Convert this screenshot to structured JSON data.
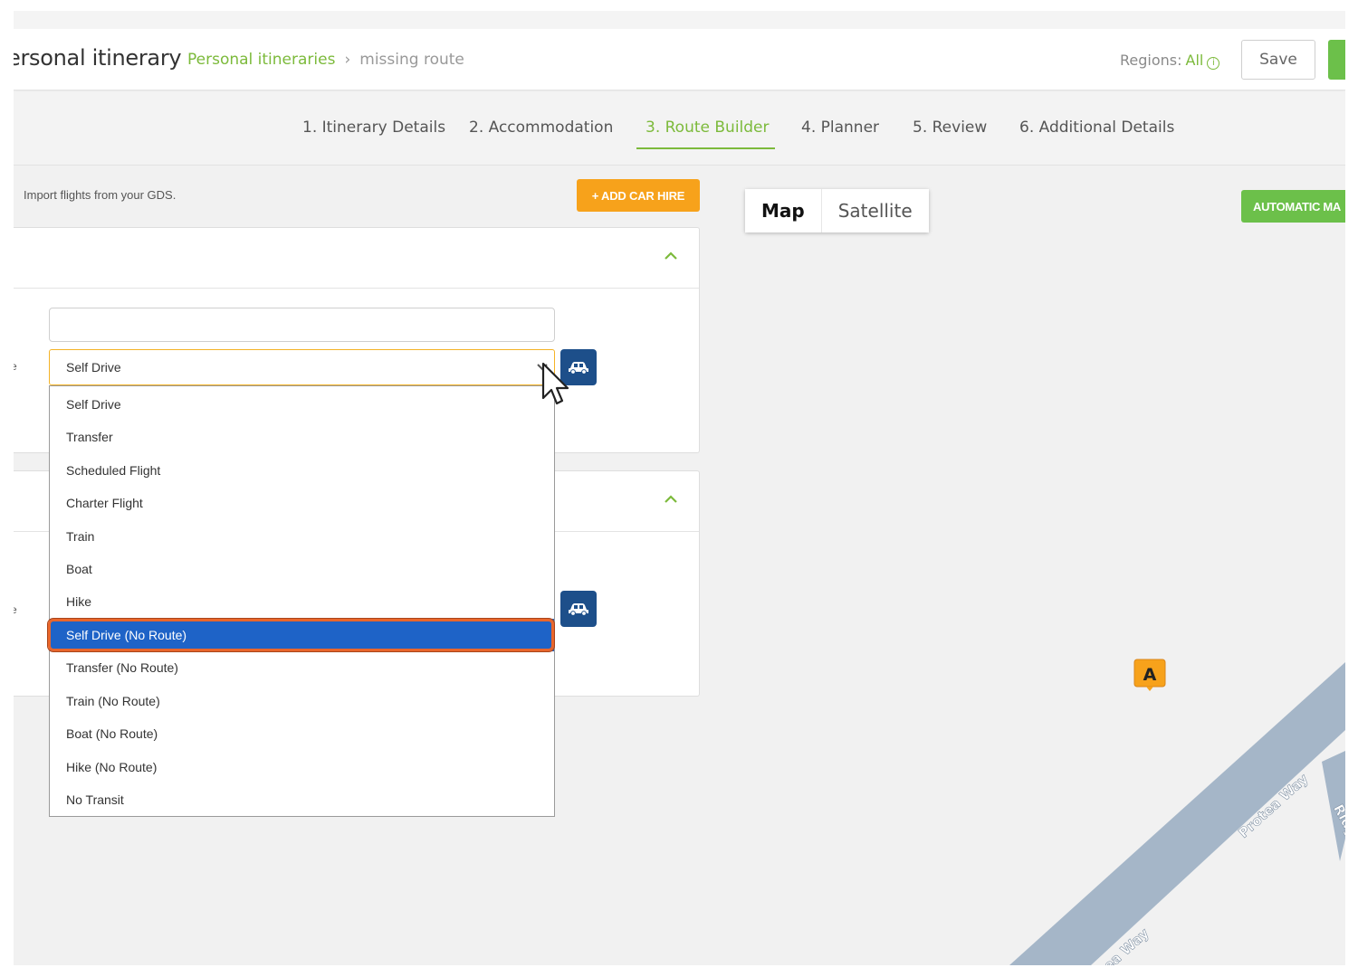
{
  "header": {
    "title": "ersonal itinerary",
    "breadcrumb": {
      "link": "Personal itineraries",
      "separator": "›",
      "current": "missing route"
    },
    "regions_label": "Regions:",
    "regions_value": "All",
    "info_glyph": "i",
    "save_label": "Save"
  },
  "tabs": [
    {
      "label": "1. Itinerary Details"
    },
    {
      "label": "2. Accommodation"
    },
    {
      "label": "3. Route Builder",
      "active": true
    },
    {
      "label": "4. Planner"
    },
    {
      "label": "5. Review"
    },
    {
      "label": "6. Additional Details"
    }
  ],
  "left_pane": {
    "import_text": "Import flights from your GDS.",
    "add_car_hire_label": "+ ADD CAR HIRE",
    "stub_label": "e",
    "transport_select": {
      "value": "Self Drive"
    },
    "dropdown": {
      "options": [
        "Self Drive",
        "Transfer",
        "Scheduled Flight",
        "Charter Flight",
        "Train",
        "Boat",
        "Hike",
        "Self Drive (No Route)",
        "Transfer (No Route)",
        "Train (No Route)",
        "Boat (No Route)",
        "Hike (No Route)",
        "No Transit"
      ],
      "highlighted": "Self Drive (No Route)"
    }
  },
  "map": {
    "map_label": "Map",
    "satellite_label": "Satellite",
    "automatic_label": "AUTOMATIC MA",
    "marker_label": "A",
    "roads": [
      "Protea Way",
      "Ridge Rd",
      "Protea Way"
    ]
  },
  "colors": {
    "accent_green": "#7cba3b",
    "button_orange": "#f7a21b",
    "highlight_blue": "#1e63c7",
    "car_button_blue": "#1d4f8a",
    "annotation_orange": "#e8662c"
  }
}
